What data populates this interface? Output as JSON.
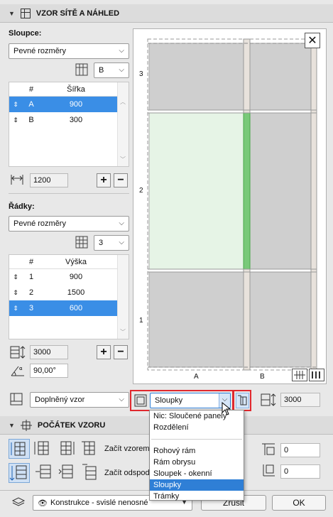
{
  "pattern_section": {
    "title": "VZOR SÍTĚ A NÁHLED"
  },
  "columns": {
    "label": "Sloupce:",
    "type_value": "Pevné rozměry",
    "count_value": "B",
    "table_headers": [
      "#",
      "Šířka"
    ],
    "rows": [
      {
        "idx": "A",
        "value": "900",
        "selected": true
      },
      {
        "idx": "B",
        "value": "300",
        "selected": false
      }
    ],
    "total_width": "1200"
  },
  "rows_section": {
    "label": "Řádky:",
    "type_value": "Pevné rozměry",
    "count_value": "3",
    "table_headers": [
      "#",
      "Výška"
    ],
    "rows": [
      {
        "idx": "1",
        "value": "900",
        "selected": false
      },
      {
        "idx": "2",
        "value": "1500",
        "selected": false
      },
      {
        "idx": "3",
        "value": "600",
        "selected": true
      }
    ],
    "total_height": "3000",
    "angle": "90,00°"
  },
  "preview": {
    "row_labels": [
      "3",
      "2",
      "1"
    ],
    "col_labels": [
      "A",
      "B"
    ]
  },
  "pattern_bar": {
    "pattern_type": "Doplněný vzor",
    "apply_to": "Sloupky",
    "height_value": "3000"
  },
  "menu": {
    "items_top": [
      "Nic: Sloučené panely",
      "Rozdělení"
    ],
    "items_bottom": [
      "Rohový rám",
      "Rám obrysu",
      "Sloupek - okenní",
      "Sloupky",
      "Trámky"
    ],
    "selected": "Sloupky"
  },
  "origin_section": {
    "title": "POČÁTEK VZORU",
    "start_label": "Začít vzorem",
    "offset_label": "Začít odspod",
    "offset_x": "0",
    "offset_y": "0"
  },
  "footer": {
    "layer_value": "Konstrukce - svislé nenosné",
    "cancel_label": "Zrušit",
    "ok_label": "OK"
  }
}
